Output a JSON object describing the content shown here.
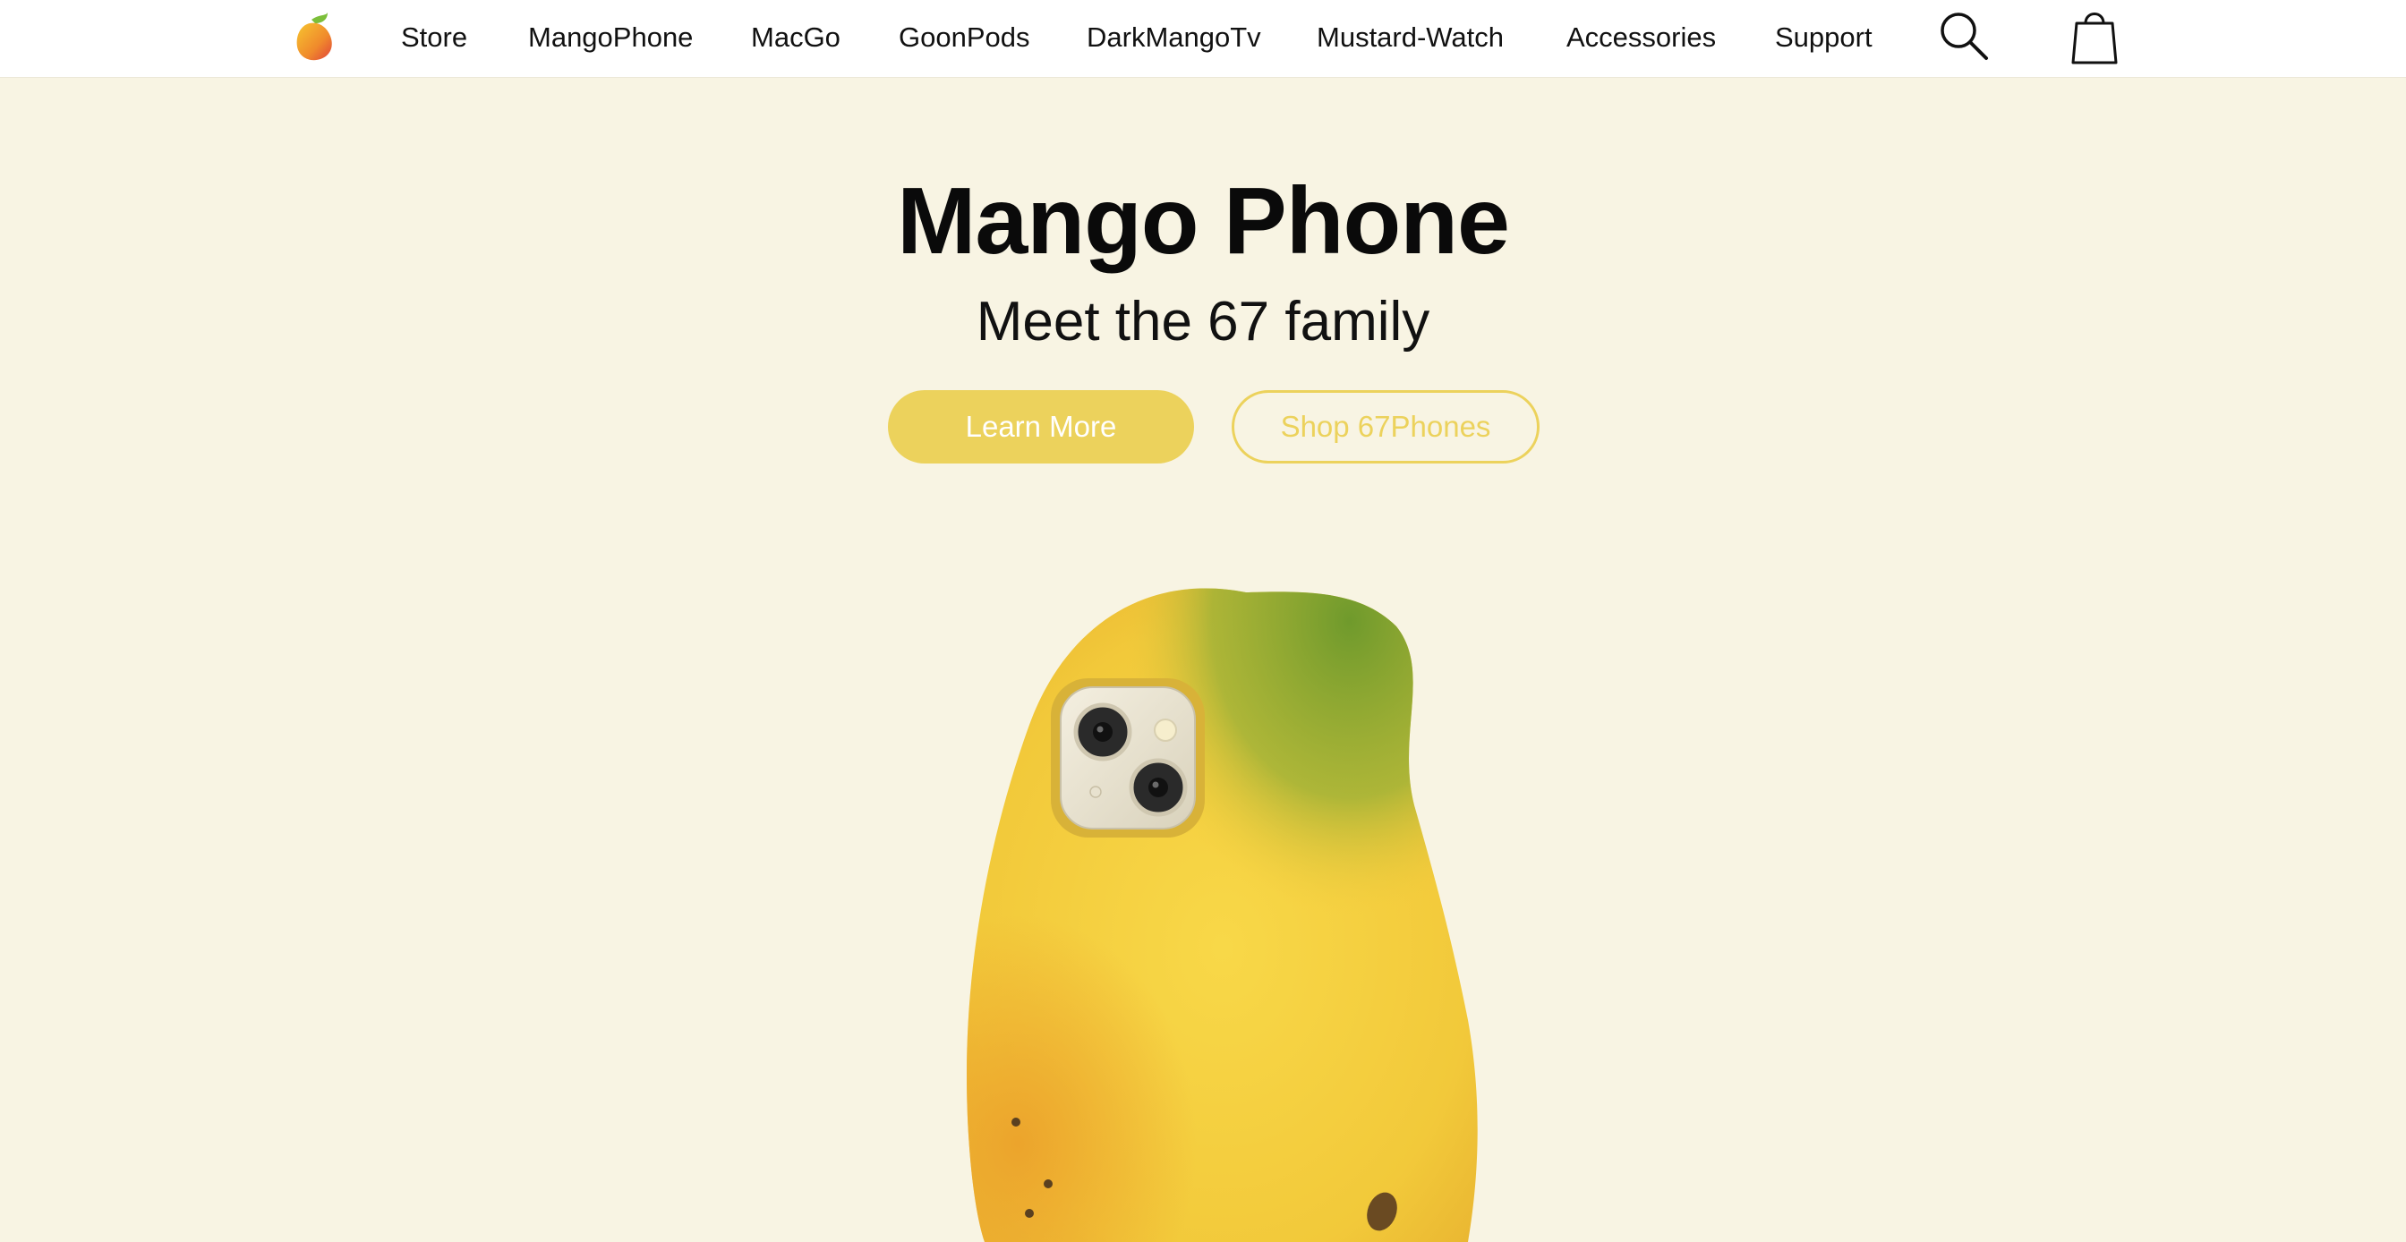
{
  "nav": {
    "links": [
      "Store",
      "MangoPhone",
      "MacGo",
      "GoonPods",
      "DarkMangoTv",
      "Mustard-Watch",
      "Accessories",
      "Support"
    ],
    "logo_icon": "mango-logo-icon",
    "search_icon": "search-icon",
    "bag_icon": "shopping-bag-icon"
  },
  "hero": {
    "title": "Mango Phone",
    "subtitle": "Meet the 67 family",
    "primary_button": "Learn More",
    "secondary_button": "Shop 67Phones",
    "image": "mango-phone-case-image"
  },
  "colors": {
    "background": "#f8f4e3",
    "accent": "#ecd25c",
    "nav_background": "#ffffff"
  }
}
